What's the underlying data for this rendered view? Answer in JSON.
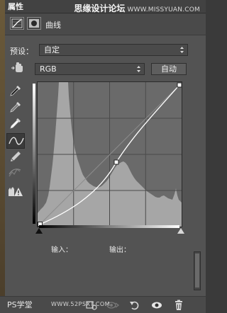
{
  "titlebar": {
    "tab_label": "属性",
    "watermark_cn": "思缘设计论坛",
    "watermark_url": "WWW.MISSYUAN.COM"
  },
  "header": {
    "curves_label": "曲线"
  },
  "preset": {
    "label": "预设：",
    "value": "自定"
  },
  "channel": {
    "value": "RGB",
    "auto_label": "自动"
  },
  "io": {
    "input_label": "输入：",
    "output_label": "输出："
  },
  "footer": {
    "watermark_brand": "PS学堂",
    "watermark_url": "WWW.52PSXT.COM"
  },
  "colors": {
    "panel_bg": "#535353",
    "graph_bg": "#6a6a6a",
    "histogram": "#a8a8a8",
    "curve": "#ffffff"
  },
  "icons": {
    "curves_adjustment": "curves-icon",
    "mask": "mask-icon",
    "target_adjust": "hand-icon",
    "eyedropper_black": "eyedropper-icon",
    "eyedropper_gray": "eyedropper-icon",
    "eyedropper_white": "eyedropper-icon",
    "edit_points": "curve-tool-icon",
    "pencil": "pencil-icon",
    "smooth": "smooth-icon",
    "clipping_warning": "warning-icon",
    "clip_to_layer": "clip-icon",
    "view_previous": "eye-icon",
    "reset": "reset-icon",
    "visibility": "eye-icon",
    "delete": "trash-icon"
  }
}
